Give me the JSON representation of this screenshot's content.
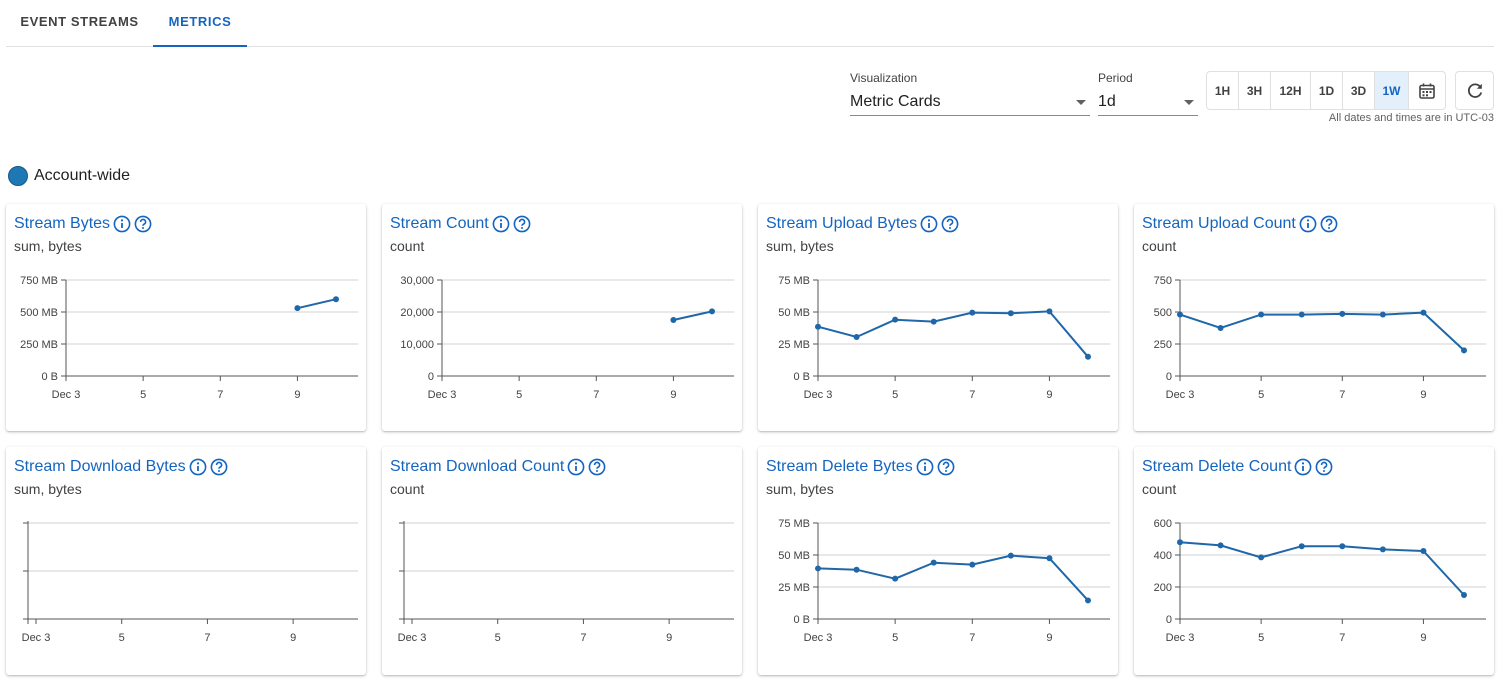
{
  "tabs": [
    {
      "label": "EVENT STREAMS",
      "active": false
    },
    {
      "label": "METRICS",
      "active": true
    }
  ],
  "controls": {
    "visualization": {
      "label": "Visualization",
      "value": "Metric Cards"
    },
    "period": {
      "label": "Period",
      "value": "1d"
    },
    "ranges": [
      "1H",
      "3H",
      "12H",
      "1D",
      "3D",
      "1W"
    ],
    "active_range": "1W",
    "calendar_icon": "calendar-icon",
    "refresh_icon": "refresh-icon",
    "timezone_note": "All dates and times are in UTC-03"
  },
  "legend": {
    "label": "Account-wide",
    "color": "#1f77b4"
  },
  "colors": {
    "accent": "#1565c0",
    "series": "#1f67a8"
  },
  "chart_data": [
    {
      "type": "line",
      "title": "Stream Bytes",
      "subtitle": "sum, bytes",
      "x": [
        3,
        4,
        5,
        6,
        7,
        8,
        9,
        10
      ],
      "xticks": [
        "Dec 3",
        "5",
        "7",
        "9"
      ],
      "xtick_values": [
        3,
        5,
        7,
        9
      ],
      "yticks": [
        "0 B",
        "250 MB",
        "500 MB",
        "750 MB"
      ],
      "ylim": [
        0,
        750
      ],
      "values": [
        null,
        null,
        null,
        null,
        null,
        null,
        530,
        600
      ],
      "grid": true
    },
    {
      "type": "line",
      "title": "Stream Count",
      "subtitle": "count",
      "x": [
        3,
        4,
        5,
        6,
        7,
        8,
        9,
        10
      ],
      "xticks": [
        "Dec 3",
        "5",
        "7",
        "9"
      ],
      "xtick_values": [
        3,
        5,
        7,
        9
      ],
      "yticks": [
        "0",
        "10,000",
        "20,000",
        "30,000"
      ],
      "ylim": [
        0,
        30000
      ],
      "values": [
        null,
        null,
        null,
        null,
        null,
        null,
        17500,
        20200
      ],
      "grid": true
    },
    {
      "type": "line",
      "title": "Stream Upload Bytes",
      "subtitle": "sum, bytes",
      "x": [
        3,
        4,
        5,
        6,
        7,
        8,
        9,
        10
      ],
      "xticks": [
        "Dec 3",
        "5",
        "7",
        "9"
      ],
      "xtick_values": [
        3,
        5,
        7,
        9
      ],
      "yticks": [
        "0 B",
        "25 MB",
        "50 MB",
        "75 MB"
      ],
      "ylim": [
        0,
        75
      ],
      "values": [
        38.5,
        30.5,
        44,
        42.5,
        49.5,
        49,
        50.5,
        15
      ],
      "grid": true
    },
    {
      "type": "line",
      "title": "Stream Upload Count",
      "subtitle": "count",
      "x": [
        3,
        4,
        5,
        6,
        7,
        8,
        9,
        10
      ],
      "xticks": [
        "Dec 3",
        "5",
        "7",
        "9"
      ],
      "xtick_values": [
        3,
        5,
        7,
        9
      ],
      "yticks": [
        "0",
        "250",
        "500",
        "750"
      ],
      "ylim": [
        0,
        750
      ],
      "values": [
        480,
        375,
        480,
        480,
        485,
        480,
        495,
        200
      ],
      "grid": true
    },
    {
      "type": "line",
      "title": "Stream Download Bytes",
      "subtitle": "sum, bytes",
      "x": [
        3,
        4,
        5,
        6,
        7,
        8,
        9,
        10
      ],
      "xticks": [
        "Dec 3",
        "5",
        "7",
        "9"
      ],
      "xtick_values": [
        3,
        5,
        7,
        9
      ],
      "yticks": [
        "",
        "",
        ""
      ],
      "ylim": [
        0,
        2
      ],
      "values": [],
      "grid": true
    },
    {
      "type": "line",
      "title": "Stream Download Count",
      "subtitle": "count",
      "x": [
        3,
        4,
        5,
        6,
        7,
        8,
        9,
        10
      ],
      "xticks": [
        "Dec 3",
        "5",
        "7",
        "9"
      ],
      "xtick_values": [
        3,
        5,
        7,
        9
      ],
      "yticks": [
        "",
        "",
        ""
      ],
      "ylim": [
        0,
        2
      ],
      "values": [],
      "grid": true
    },
    {
      "type": "line",
      "title": "Stream Delete Bytes",
      "subtitle": "sum, bytes",
      "x": [
        3,
        4,
        5,
        6,
        7,
        8,
        9,
        10
      ],
      "xticks": [
        "Dec 3",
        "5",
        "7",
        "9"
      ],
      "xtick_values": [
        3,
        5,
        7,
        9
      ],
      "yticks": [
        "0 B",
        "25 MB",
        "50 MB",
        "75 MB"
      ],
      "ylim": [
        0,
        75
      ],
      "values": [
        39.5,
        38.5,
        31.5,
        44,
        42.5,
        49.5,
        47.5,
        14.5
      ],
      "grid": true
    },
    {
      "type": "line",
      "title": "Stream Delete Count",
      "subtitle": "count",
      "x": [
        3,
        4,
        5,
        6,
        7,
        8,
        9,
        10
      ],
      "xticks": [
        "Dec 3",
        "5",
        "7",
        "9"
      ],
      "xtick_values": [
        3,
        5,
        7,
        9
      ],
      "yticks": [
        "0",
        "200",
        "400",
        "600"
      ],
      "ylim": [
        0,
        600
      ],
      "values": [
        480,
        460,
        385,
        455,
        455,
        435,
        425,
        150
      ],
      "grid": true
    }
  ]
}
